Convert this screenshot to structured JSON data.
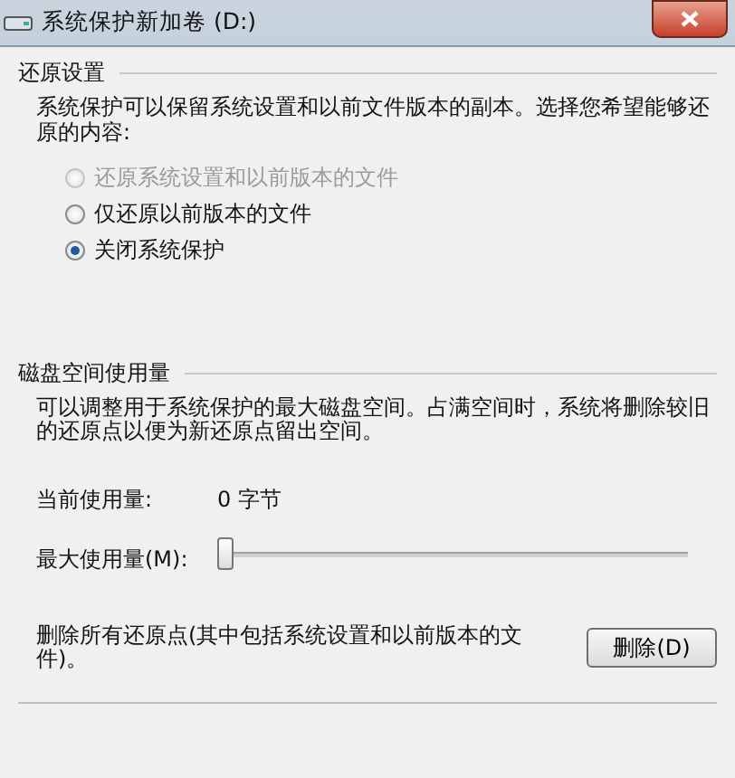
{
  "window": {
    "title": "系统保护新加卷 (D:)"
  },
  "restore_settings": {
    "heading": "还原设置",
    "description": "系统保护可以保留系统设置和以前文件版本的副本。选择您希望能够还原的内容:",
    "options": [
      {
        "label": "还原系统设置和以前版本的文件",
        "selected": false,
        "disabled": true
      },
      {
        "label": "仅还原以前版本的文件",
        "selected": false,
        "disabled": false
      },
      {
        "label": "关闭系统保护",
        "selected": true,
        "disabled": false
      }
    ]
  },
  "disk_space": {
    "heading": "磁盘空间使用量",
    "description": "可以调整用于系统保护的最大磁盘空间。占满空间时，系统将删除较旧的还原点以便为新还原点留出空间。",
    "current_usage_label": "当前使用量:",
    "current_usage_value": "0 字节",
    "max_usage_label": "最大使用量(M):",
    "max_usage_slider": {
      "level": 0
    },
    "delete_text": "删除所有还原点(其中包括系统设置和以前版本的文件)。",
    "delete_button": "删除(D)"
  }
}
